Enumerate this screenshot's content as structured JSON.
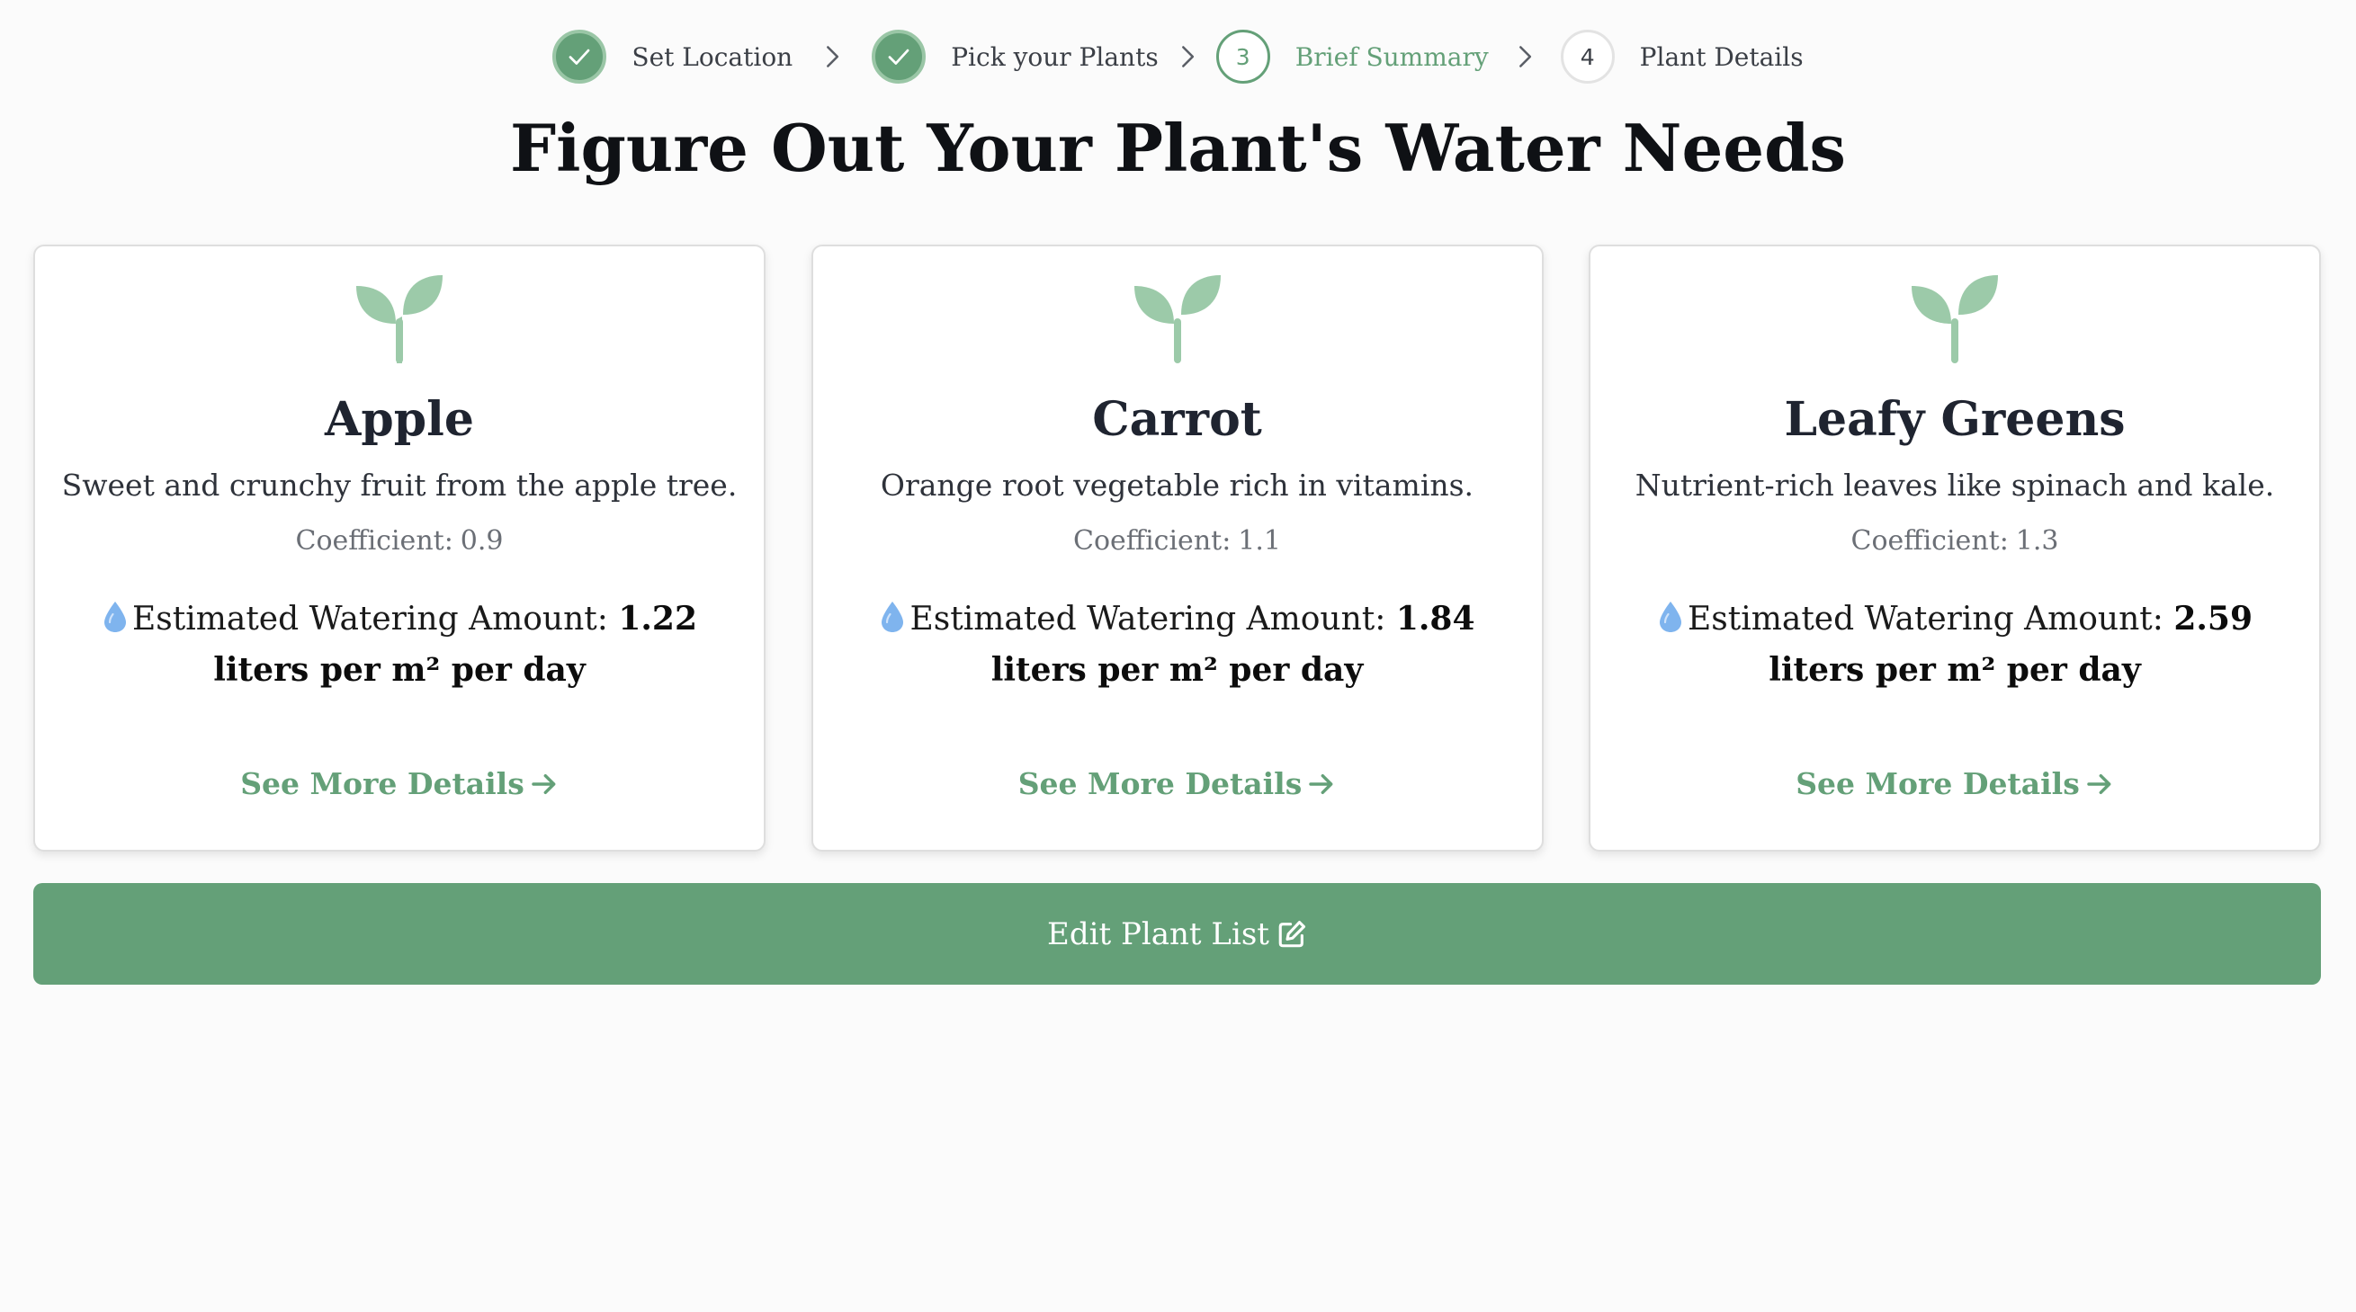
{
  "stepper": {
    "steps": [
      {
        "label": "Set Location",
        "status": "done",
        "number": ""
      },
      {
        "label": "Pick your Plants",
        "status": "done",
        "number": ""
      },
      {
        "label": "Brief Summary",
        "status": "current",
        "number": "3"
      },
      {
        "label": "Plant Details",
        "status": "pending",
        "number": "4"
      }
    ]
  },
  "page": {
    "title": "Figure Out Your Plant's Water Needs"
  },
  "cards": [
    {
      "name": "Apple",
      "description": "Sweet and crunchy fruit from the apple tree.",
      "coefficient_label": "Coefficient:",
      "coefficient": "0.9",
      "water_label": "Estimated Watering Amount:",
      "water_amount": "1.22 liters per m² per day",
      "link_label": "See More Details"
    },
    {
      "name": "Carrot",
      "description": "Orange root vegetable rich in vitamins.",
      "coefficient_label": "Coefficient:",
      "coefficient": "1.1",
      "water_label": "Estimated Watering Amount:",
      "water_amount": "1.84 liters per m² per day",
      "link_label": "See More Details"
    },
    {
      "name": "Leafy Greens",
      "description": "Nutrient-rich leaves like spinach and kale.",
      "coefficient_label": "Coefficient:",
      "coefficient": "1.3",
      "water_label": "Estimated Watering Amount:",
      "water_amount": "2.59 liters per m² per day",
      "link_label": "See More Details"
    }
  ],
  "actions": {
    "edit_label": "Edit Plant List"
  },
  "icons": {
    "step_done": "check-icon",
    "step_separator": "chevron-right-icon",
    "plant": "sprout-icon",
    "water": "water-drop-icon",
    "link": "arrow-right-icon",
    "edit": "edit-icon"
  },
  "colors": {
    "accent": "#64a078",
    "accent_light": "#9ac6a6",
    "sprout": "#9ccaa9",
    "water_drop": "#7fb4ee",
    "title": "#0f1115",
    "background": "#fbfbfb"
  }
}
